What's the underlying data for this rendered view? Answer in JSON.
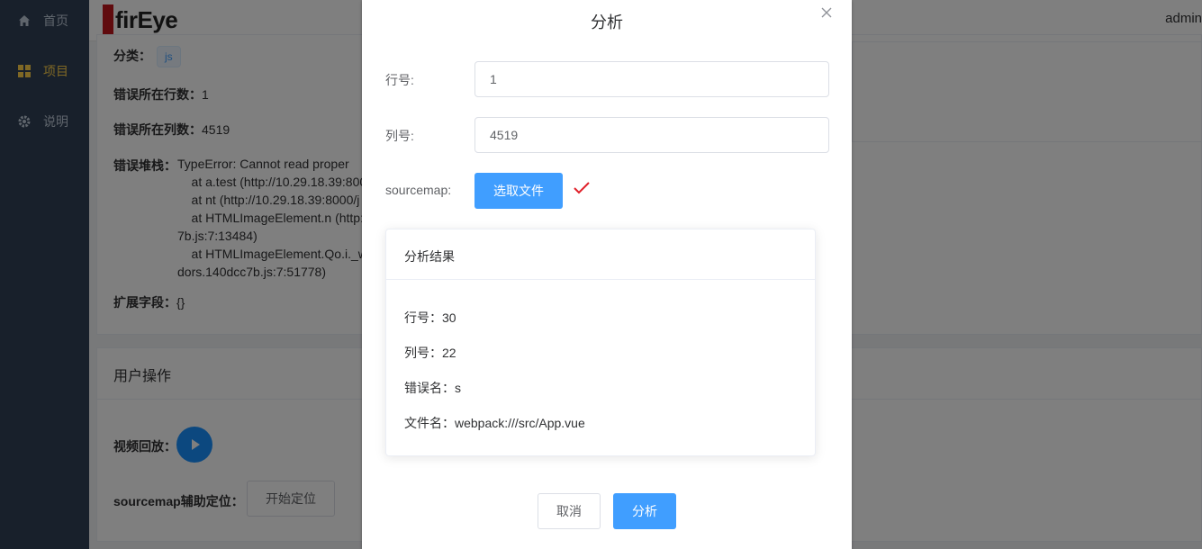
{
  "sidebar": {
    "items": [
      {
        "label": "首页",
        "icon": "home-icon"
      },
      {
        "label": "项目",
        "icon": "grid-icon",
        "active": true
      },
      {
        "label": "说明",
        "icon": "gear-icon"
      }
    ]
  },
  "header": {
    "logo_text": "firEye",
    "user": "admin"
  },
  "detail": {
    "category_label": "分类：",
    "category_tag": "js",
    "row_label": "错误所在行数：",
    "row_value": "1",
    "col_label": "错误所在列数：",
    "col_value": "4519",
    "stack_label": "错误堆栈：",
    "stack_lines": "TypeError: Cannot read proper\n    at a.test (http://10.29.18.39:800\n    at nt (http://10.29.18.39:8000/j\n    at HTMLImageElement.n (http:\n7b.js:7:13484)\n    at HTMLImageElement.Qo.i._w\ndors.140dcc7b.js:7:51778)",
    "ext_label": "扩展字段：",
    "ext_value": "{}"
  },
  "user_ops": {
    "title": "用户操作",
    "video_label": "视频回放：",
    "sourcemap_label": "sourcemap辅助定位：",
    "locate_button": "开始定位"
  },
  "dialog": {
    "title": "分析",
    "line_label": "行号:",
    "line_value": "1",
    "col_label": "列号:",
    "col_value": "4519",
    "sourcemap_label": "sourcemap:",
    "choose_file_button": "选取文件",
    "result": {
      "title": "分析结果",
      "line": "行号：30",
      "column": "列号：22",
      "error_name": "错误名：s",
      "file_name": "文件名：webpack:///src/App.vue"
    },
    "cancel_button": "取消",
    "analyze_button": "分析"
  },
  "colors": {
    "primary": "#409eff",
    "sidebar_bg": "#304156",
    "active_nav": "#ffd04b",
    "check": "#e0202a"
  }
}
